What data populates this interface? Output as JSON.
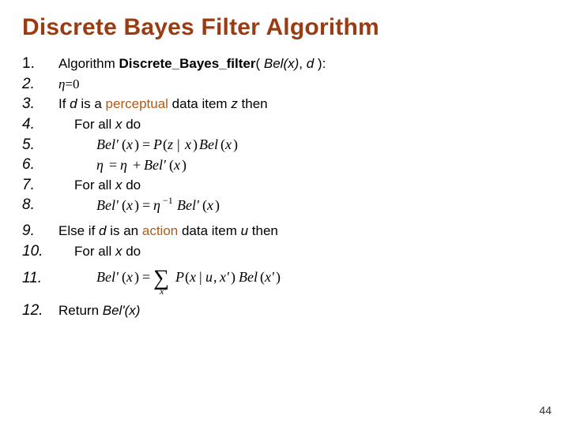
{
  "title": "Discrete Bayes Filter Algorithm",
  "nums": {
    "n1": "1.",
    "n2": "2.",
    "n3": "3.",
    "n4": "4.",
    "n5": "5.",
    "n6": "6.",
    "n7": "7.",
    "n8": "8.",
    "n9": "9.",
    "n10": "10.",
    "n11": "11.",
    "n12": "12."
  },
  "line1": {
    "pre": "Algorithm ",
    "name": "Discrete_Bayes_filter",
    "args_open": "( ",
    "arg1": "Bel(x)",
    "sep": ", ",
    "arg2": "d",
    "args_close": " ):"
  },
  "line2": {
    "eta": "η",
    "eq0": "=0"
  },
  "line3": {
    "if": "If ",
    "d": "d",
    "is_a": " is a ",
    "perceptual": "perceptual",
    "rest": " data item ",
    "z": "z",
    "then": " then"
  },
  "line4": {
    "forall": "For all ",
    "x": "x",
    "do": " do"
  },
  "line7": {
    "forall": "For all ",
    "x": "x",
    "do": " do"
  },
  "line9": {
    "elseif": "Else if ",
    "d": "d",
    "is_an": " is an ",
    "action": "action",
    "rest": " data item ",
    "u": "u",
    "then": " then"
  },
  "line10": {
    "forall": "For all ",
    "x": "x",
    "do": " do"
  },
  "line12": {
    "ret": "Return ",
    "bel": "Bel'(x)"
  },
  "pagenum": "44",
  "chart_data": {
    "type": "table",
    "title": "Discrete Bayes Filter Algorithm pseudocode",
    "steps": [
      {
        "n": 1,
        "text": "Algorithm Discrete_Bayes_filter( Bel(x), d ):"
      },
      {
        "n": 2,
        "text": "η = 0"
      },
      {
        "n": 3,
        "text": "If d is a perceptual data item z then"
      },
      {
        "n": 4,
        "text": "  For all x do"
      },
      {
        "n": 5,
        "text": "    Bel'(x) = P(z | x) Bel(x)"
      },
      {
        "n": 6,
        "text": "    η = η + Bel'(x)"
      },
      {
        "n": 7,
        "text": "  For all x do"
      },
      {
        "n": 8,
        "text": "    Bel'(x) = η^{-1} Bel'(x)"
      },
      {
        "n": 9,
        "text": "Else if d is an action data item u then"
      },
      {
        "n": 10,
        "text": "  For all x do"
      },
      {
        "n": 11,
        "text": "    Bel'(x) = Σ_{x'} P(x | u, x') Bel(x')"
      },
      {
        "n": 12,
        "text": "Return Bel'(x)"
      }
    ]
  }
}
